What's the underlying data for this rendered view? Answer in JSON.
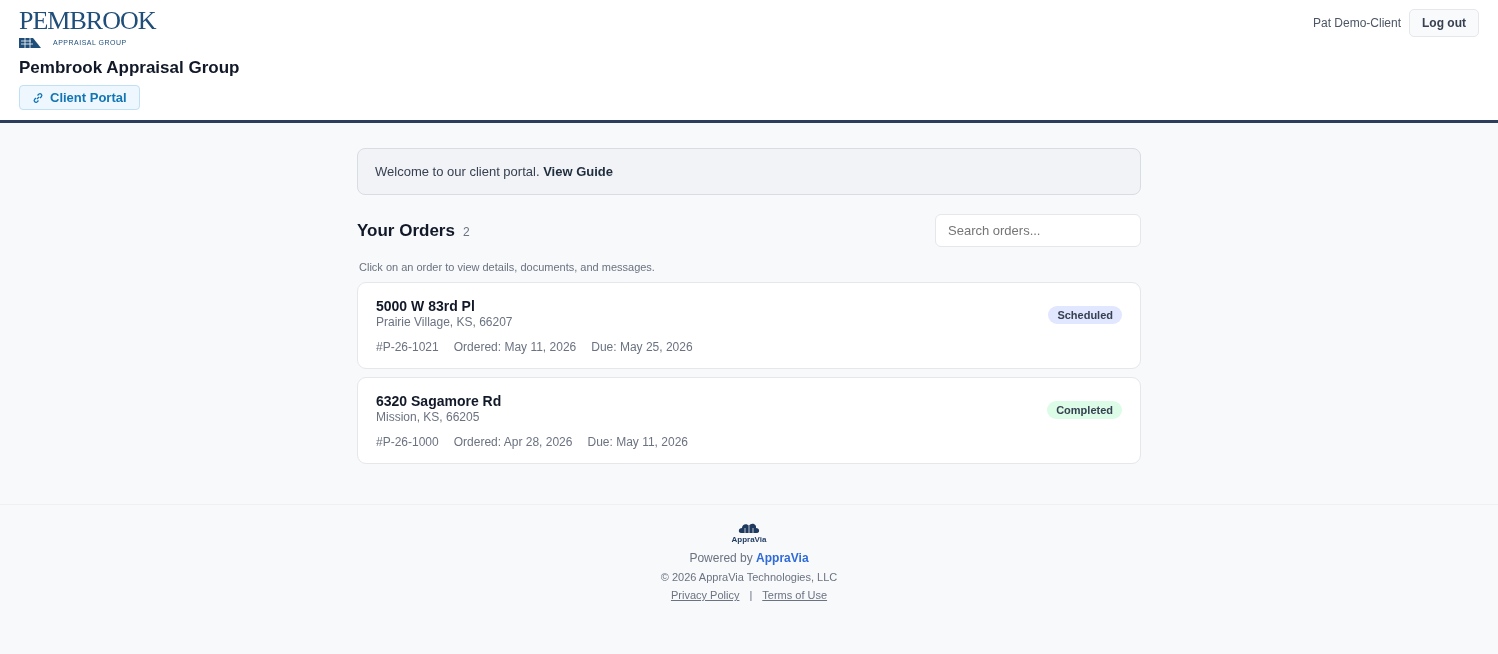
{
  "header": {
    "logo": {
      "wordmark": "PEMBROOK",
      "tagline": "APPRAISAL GROUP"
    },
    "company": "Pembrook Appraisal Group",
    "portal_tag": "Client Portal",
    "user": "Pat Demo-Client",
    "logout": "Log out"
  },
  "banner": {
    "text": "Welcome to our client portal.",
    "link": "View Guide"
  },
  "orders_section": {
    "title": "Your Orders",
    "count": "2",
    "search": {
      "placeholder": "Search orders..."
    },
    "hint": "Click on an order to view details, documents, and messages."
  },
  "orders": [
    {
      "address": "5000 W 83rd Pl",
      "city": "Prairie Village, KS, 66207",
      "number": "#P-26-1021",
      "ordered": "Ordered: May 11, 2026",
      "due": "Due: May 25, 2026",
      "status": "Scheduled",
      "color": "#e0e7ff"
    },
    {
      "address": "6320 Sagamore Rd",
      "city": "Mission, KS, 66205",
      "number": "#P-26-1000",
      "ordered": "Ordered: Apr 28, 2026",
      "due": "Due: May 11, 2026",
      "status": "Completed",
      "color": "#dcfce7"
    }
  ],
  "footer": {
    "logo_text": "AppraVia",
    "powered_by": "Powered by",
    "brand": "AppraVia",
    "copyright": "© 2026 AppraVia Technologies, LLC",
    "links": [
      "Privacy Policy",
      "Terms of Use"
    ],
    "separator": "|"
  }
}
